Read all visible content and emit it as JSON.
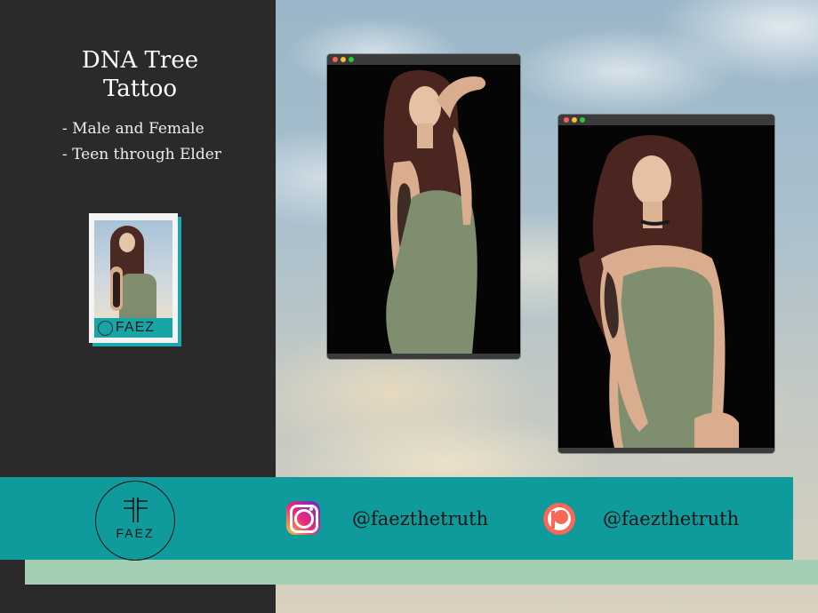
{
  "title": {
    "line1": "DNA Tree",
    "line2": "Tattoo"
  },
  "details": [
    "- Male and Female",
    "- Teen through Elder"
  ],
  "thumbnail": {
    "label": "FAEZ"
  },
  "logo": {
    "text": "FAEZ"
  },
  "social": {
    "instagram": {
      "icon": "instagram-icon",
      "handle": "@faezthetruth"
    },
    "patreon": {
      "icon": "patreon-icon",
      "handle": "@faezthetruth"
    }
  },
  "colors": {
    "panel": "#2a2a2a",
    "banner": "#0f9a9b",
    "accent_mint": "#a4ceb3",
    "thumb_label": "#19a4a6"
  }
}
